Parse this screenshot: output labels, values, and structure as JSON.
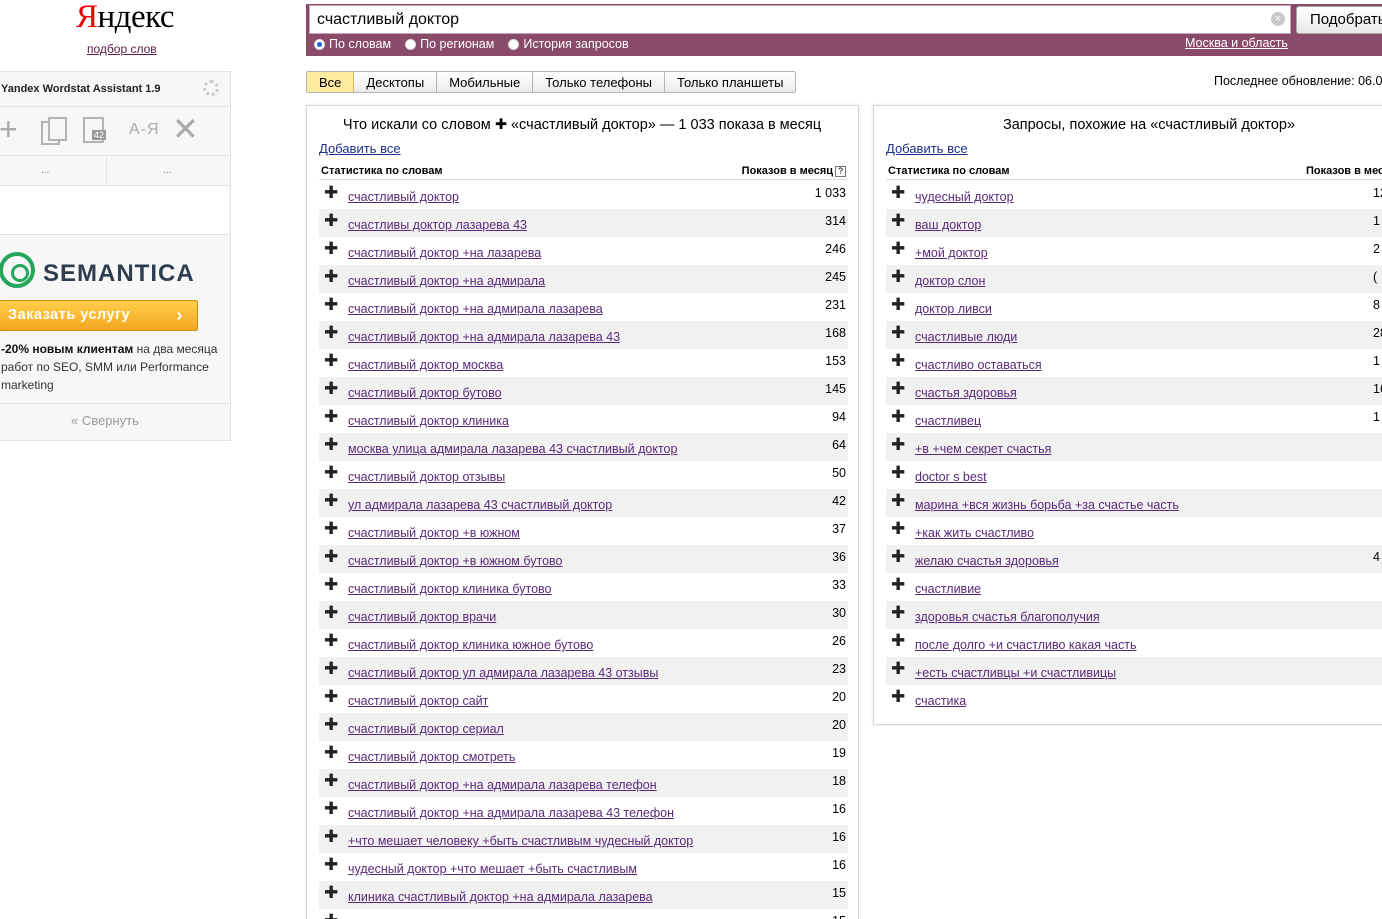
{
  "logo": {
    "first": "Я",
    "rest": "ндекс",
    "sub": "подбор слов"
  },
  "search": {
    "query": "счастливый доктор",
    "clear": "×",
    "submit": "Подобрать",
    "radios": [
      {
        "label": "По словам",
        "checked": true
      },
      {
        "label": "По регионам",
        "checked": false
      },
      {
        "label": "История запросов",
        "checked": false
      }
    ],
    "region": "Москва и область"
  },
  "tabs": [
    "Все",
    "Десктопы",
    "Мобильные",
    "Только телефоны",
    "Только планшеты"
  ],
  "last_update": "Последнее обновление: 06.0",
  "left": {
    "title_pre": "Что искали со словом ",
    "title_post": " «счастливый доктор» — 1 033 показа в месяц",
    "add_all": "Добавить все",
    "col_phrase": "Статистика по словам",
    "col_count": "Показов в месяц",
    "qmark": "?",
    "rows": [
      {
        "phrase": "счастливый доктор",
        "count": "1 033"
      },
      {
        "phrase": "счастливы доктор лазарева 43",
        "count": "314"
      },
      {
        "phrase": "счастливый доктор +на лазарева",
        "count": "246"
      },
      {
        "phrase": "счастливый доктор +на адмирала",
        "count": "245"
      },
      {
        "phrase": "счастливый доктор +на адмирала лазарева",
        "count": "231"
      },
      {
        "phrase": "счастливый доктор +на адмирала лазарева 43",
        "count": "168"
      },
      {
        "phrase": "счастливый доктор москва",
        "count": "153"
      },
      {
        "phrase": "счастливый доктор бутово",
        "count": "145"
      },
      {
        "phrase": "счастливый доктор клиника",
        "count": "94"
      },
      {
        "phrase": "москва улица адмирала лазарева 43 счастливый доктор",
        "count": "64"
      },
      {
        "phrase": "счастливый доктор отзывы",
        "count": "50"
      },
      {
        "phrase": "ул адмирала лазарева 43 счастливый доктор",
        "count": "42"
      },
      {
        "phrase": "счастливый доктор +в южном",
        "count": "37"
      },
      {
        "phrase": "счастливый доктор +в южном бутово",
        "count": "36"
      },
      {
        "phrase": "счастливый доктор клиника бутово",
        "count": "33"
      },
      {
        "phrase": "счастливый доктор врачи",
        "count": "30"
      },
      {
        "phrase": "счастливый доктор клиника южное бутово",
        "count": "26"
      },
      {
        "phrase": "счастливый доктор ул адмирала лазарева 43 отзывы",
        "count": "23"
      },
      {
        "phrase": "счастливый доктор сайт",
        "count": "20"
      },
      {
        "phrase": "счастливый доктор сериал",
        "count": "20"
      },
      {
        "phrase": "счастливый доктор смотреть",
        "count": "19"
      },
      {
        "phrase": "счастливый доктор +на адмирала лазарева телефон",
        "count": "18"
      },
      {
        "phrase": "счастливый доктор +на адмирала лазарева 43 телефон",
        "count": "16"
      },
      {
        "phrase": "+что мешает человеку +быть счастливым чудесный доктор",
        "count": "16"
      },
      {
        "phrase": "чудесный доктор +что мешает +быть счастливым",
        "count": "16"
      },
      {
        "phrase": "клиника счастливый доктор +на адмирала лазарева",
        "count": "15"
      },
      {
        "phrase": "",
        "count": "15"
      }
    ]
  },
  "right": {
    "title": "Запросы, похожие на «счастливый доктор»",
    "add_all": "Добавить все",
    "col_phrase": "Статистика по словам",
    "col_count": "Показов в мес",
    "rows": [
      {
        "phrase": "чудесный доктор",
        "count": "12"
      },
      {
        "phrase": "ваш доктор",
        "count": "1"
      },
      {
        "phrase": "+мой доктор",
        "count": "2"
      },
      {
        "phrase": "доктор слон",
        "count": "("
      },
      {
        "phrase": "доктор ливси",
        "count": "8"
      },
      {
        "phrase": "счастливые люди",
        "count": "28"
      },
      {
        "phrase": "счастливо оставаться",
        "count": "1"
      },
      {
        "phrase": "счастья здоровья",
        "count": "16"
      },
      {
        "phrase": "счастливец",
        "count": "1"
      },
      {
        "phrase": "+в +чем секрет счастья",
        "count": ""
      },
      {
        "phrase": "doctor s best",
        "count": ""
      },
      {
        "phrase": "марина +вся жизнь борьба +за счастье часть",
        "count": ""
      },
      {
        "phrase": "+как жить счастливо",
        "count": ""
      },
      {
        "phrase": "желаю счастья здоровья",
        "count": "4"
      },
      {
        "phrase": "счастливие",
        "count": ""
      },
      {
        "phrase": "здоровья счастья благополучия",
        "count": ""
      },
      {
        "phrase": "после долго +и счастливо какая часть",
        "count": ""
      },
      {
        "phrase": "+есть счастливцы +и счастливицы",
        "count": ""
      },
      {
        "phrase": "счастика",
        "count": ""
      }
    ]
  },
  "extension": {
    "title": "Yandex Wordstat Assistant 1.9",
    "count_badge": "42",
    "az": "А-Я",
    "dots": [
      "...",
      "..."
    ],
    "brand": "SEMANTICA",
    "order": "Заказать услугу",
    "chev": "›",
    "promo_bold": "-20% новым клиентам",
    "promo_rest": " на два месяца работ по SEO, SMM или Performance marketing",
    "collapse": "« Свернуть"
  }
}
